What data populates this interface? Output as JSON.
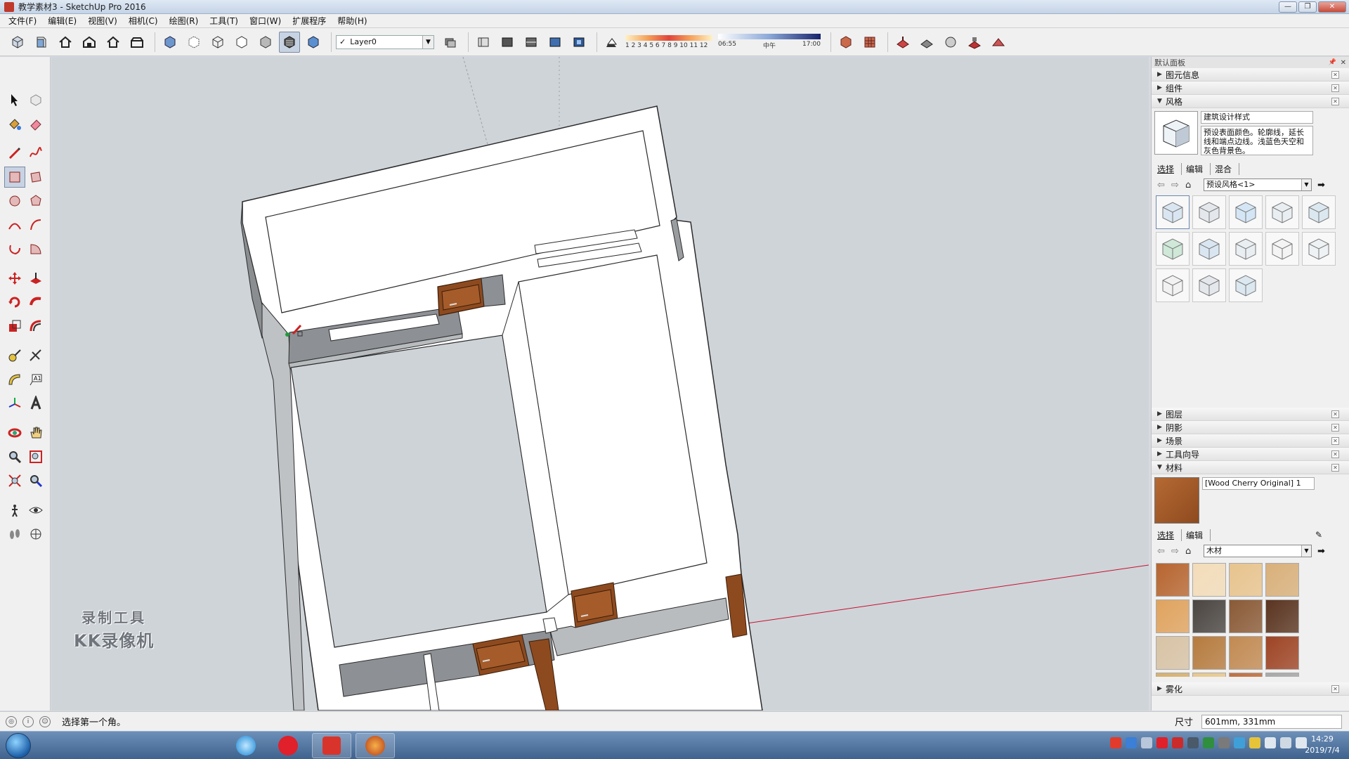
{
  "window": {
    "title": "教学素材3 - SketchUp Pro 2016"
  },
  "menu": [
    "文件(F)",
    "编辑(E)",
    "视图(V)",
    "相机(C)",
    "绘图(R)",
    "工具(T)",
    "窗口(W)",
    "扩展程序",
    "帮助(H)"
  ],
  "toolbar": {
    "layer_value": "Layer0",
    "shadow_months": "1 2 3 4 5 6 7 8 9 10 11 12",
    "time_start": "06:55",
    "time_mid": "中午",
    "time_end": "17:00"
  },
  "watermark": {
    "line1": "录制工具",
    "line2": "KK录像机"
  },
  "panel": {
    "header": "默认面板",
    "trays_top": [
      "图元信息",
      "组件"
    ],
    "styles_tray": "风格",
    "style_name": "建筑设计样式",
    "style_desc": "预设表面颜色。轮廓线，延长线和端点边线。浅蓝色天空和灰色背景色。",
    "style_tabs": [
      "选择",
      "编辑",
      "混合"
    ],
    "style_collection": "预设风格<1>",
    "trays_bottom": [
      "图层",
      "阴影",
      "场景",
      "工具向导"
    ],
    "materials_tray": "材料",
    "material_name": "[Wood Cherry Original] 1",
    "material_tabs": [
      "选择",
      "编辑"
    ],
    "material_collection": "木材",
    "last_tray": "雾化"
  },
  "materials": [
    "#b7652f",
    "#f3dcb9",
    "#e8c48e",
    "#d9b07a",
    "#e0a35e",
    "#4a4541",
    "#8a5a36",
    "#5a3420",
    "#d8c3a5",
    "#b67b3e",
    "#c28a52",
    "#9e4424",
    "#d6b170",
    "#e7c88f",
    "#c07040",
    "#a9a9a9"
  ],
  "status": {
    "message": "选择第一个角。",
    "dim_label": "尺寸",
    "dim_value": "601mm, 331mm"
  },
  "clock": {
    "time": "14:29",
    "date": "2019/7/4"
  },
  "colors": {
    "accent": "#c7d3e3",
    "wood": "#8e4a1f",
    "axis_red": "#c8102e",
    "axis_green": "#1e9e3a"
  }
}
